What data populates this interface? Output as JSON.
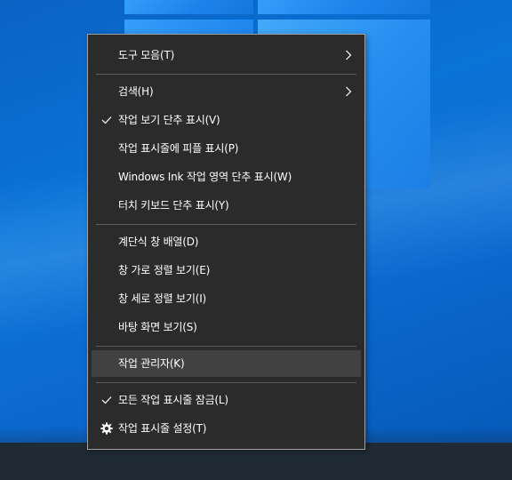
{
  "menu": {
    "items": [
      {
        "label": "도구 모음(T)",
        "submenu": true
      },
      {
        "label": "검색(H)",
        "submenu": true
      },
      {
        "label": "작업 보기 단추 표시(V)",
        "checked": true
      },
      {
        "label": "작업 표시줄에 피플 표시(P)"
      },
      {
        "label": "Windows Ink 작업 영역 단추 표시(W)"
      },
      {
        "label": "터치 키보드 단추 표시(Y)"
      },
      {
        "label": "계단식 창 배열(D)"
      },
      {
        "label": "창 가로 정렬 보기(E)"
      },
      {
        "label": "창 세로 정렬 보기(I)"
      },
      {
        "label": "바탕 화면 보기(S)"
      },
      {
        "label": "작업 관리자(K)",
        "highlighted": true
      },
      {
        "label": "모든 작업 표시줄 잠금(L)",
        "checked": true
      },
      {
        "label": "작업 표시줄 설정(T)",
        "icon": "gear-icon"
      }
    ]
  },
  "colors": {
    "menu_background": "#2b2b2b",
    "menu_text": "#ffffff",
    "highlight": "#414141",
    "separator": "#5c5c5c",
    "desktop_blue": "#0a6ad0",
    "taskbar": "#1f2a35"
  }
}
